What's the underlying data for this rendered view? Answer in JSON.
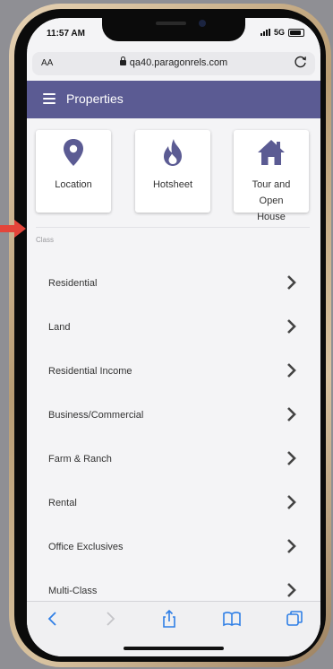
{
  "status": {
    "time": "11:57 AM",
    "network": "5G"
  },
  "browser": {
    "aa_label": "AA",
    "url": "qa40.paragonrels.com"
  },
  "app": {
    "title": "Properties"
  },
  "tiles": [
    {
      "label": "Location",
      "icon": "map-pin-icon"
    },
    {
      "label": "Hotsheet",
      "icon": "flame-icon"
    },
    {
      "label": "Tour and Open House",
      "icon": "house-icon"
    }
  ],
  "section": {
    "label": "Class"
  },
  "classes": [
    "Residential",
    "Land",
    "Residential Income",
    "Business/Commercial",
    "Farm & Ranch",
    "Rental",
    "Office Exclusives",
    "Multi-Class"
  ],
  "toolbar": {
    "icons": [
      "back-icon",
      "forward-icon",
      "share-icon",
      "bookmarks-icon",
      "tabs-icon"
    ]
  },
  "colors": {
    "accent": "#5b5b93",
    "browser_blue": "#2f7fe6",
    "pointer_arrow": "#e4453a"
  }
}
